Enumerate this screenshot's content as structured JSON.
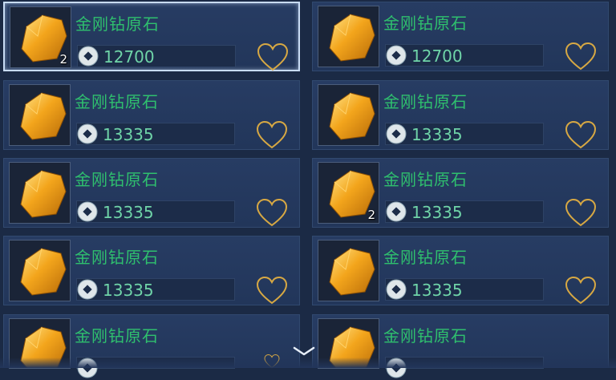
{
  "items": [
    {
      "name": "金刚钻原石",
      "price": "12700",
      "qty": "2"
    },
    {
      "name": "金刚钻原石",
      "price": "12700",
      "qty": ""
    },
    {
      "name": "金刚钻原石",
      "price": "13335",
      "qty": ""
    },
    {
      "name": "金刚钻原石",
      "price": "13335",
      "qty": ""
    },
    {
      "name": "金刚钻原石",
      "price": "13335",
      "qty": ""
    },
    {
      "name": "金刚钻原石",
      "price": "13335",
      "qty": "2"
    },
    {
      "name": "金刚钻原石",
      "price": "13335",
      "qty": ""
    },
    {
      "name": "金刚钻原石",
      "price": "13335",
      "qty": ""
    },
    {
      "name": "金刚钻原石",
      "price": "",
      "qty": ""
    },
    {
      "name": "金刚钻原石",
      "price": "",
      "qty": ""
    }
  ],
  "icons": {
    "item": "gold-ore-icon",
    "currency": "silver-coin-icon",
    "favorite": "heart-outline-icon",
    "scroll": "chevron-down-icon"
  },
  "colors": {
    "name": "#2fc06e",
    "price": "#6fd4a8",
    "heart": "#d7a843"
  }
}
